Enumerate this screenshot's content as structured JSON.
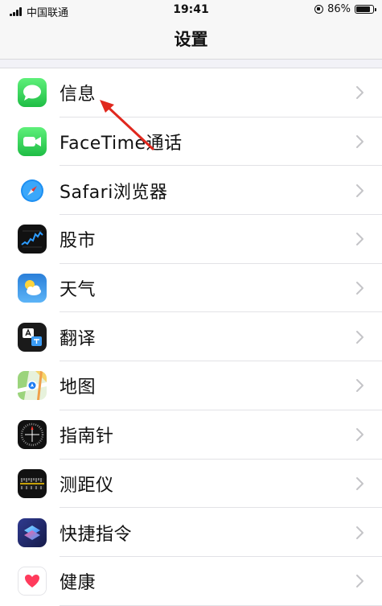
{
  "status_bar": {
    "carrier": "中国联通",
    "time": "19:41",
    "battery": "86%",
    "battery_level": 0.86
  },
  "nav": {
    "title": "设置"
  },
  "settings_items": [
    {
      "label": "信息",
      "icon": "messages-icon"
    },
    {
      "label": "FaceTime通话",
      "icon": "facetime-icon"
    },
    {
      "label": "Safari浏览器",
      "icon": "safari-icon"
    },
    {
      "label": "股市",
      "icon": "stocks-icon"
    },
    {
      "label": "天气",
      "icon": "weather-icon"
    },
    {
      "label": "翻译",
      "icon": "translate-icon"
    },
    {
      "label": "地图",
      "icon": "maps-icon"
    },
    {
      "label": "指南针",
      "icon": "compass-icon"
    },
    {
      "label": "测距仪",
      "icon": "measure-icon"
    },
    {
      "label": "快捷指令",
      "icon": "shortcuts-icon"
    },
    {
      "label": "健康",
      "icon": "health-icon"
    }
  ],
  "colors": {
    "messages_green": "#34c759",
    "facetime_green": "#30c45a",
    "annotation_red": "#e0281e"
  }
}
